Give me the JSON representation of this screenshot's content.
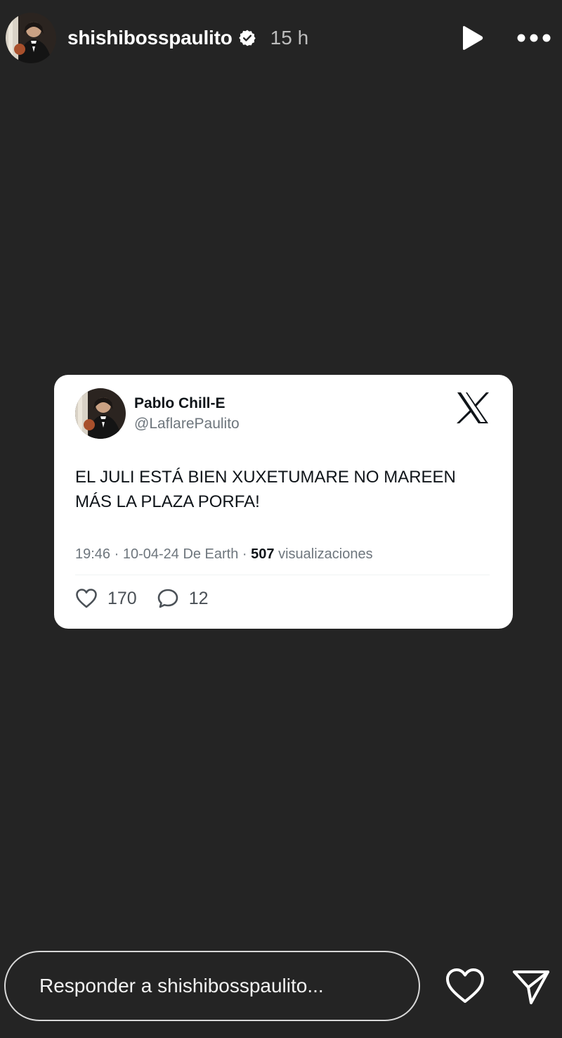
{
  "header": {
    "username": "shishibosspaulito",
    "verified_icon": "verified-badge-icon",
    "time_ago": "15 h",
    "play_icon": "play-icon",
    "more_icon": "more-dots-icon"
  },
  "tweet": {
    "author_name": "Pablo Chill-E",
    "handle": "@LaflarePaulito",
    "platform_icon": "x-logo-icon",
    "text": "EL JULI ESTÁ BIEN XUXETUMARE NO MAREEN MÁS LA PLAZA PORFA!",
    "meta_prefix": "19:46 · 10-04-24 De Earth · ",
    "views_count": "507",
    "views_label": " visualizaciones",
    "likes": "170",
    "replies": "12",
    "like_icon": "heart-icon",
    "reply_icon": "comment-icon"
  },
  "footer": {
    "reply_placeholder": "Responder a shishibosspaulito...",
    "like_icon": "heart-icon",
    "send_icon": "send-icon"
  },
  "colors": {
    "background": "#242424",
    "card": "#ffffff",
    "text_dark": "#0f1419",
    "text_muted": "#6e767d"
  }
}
